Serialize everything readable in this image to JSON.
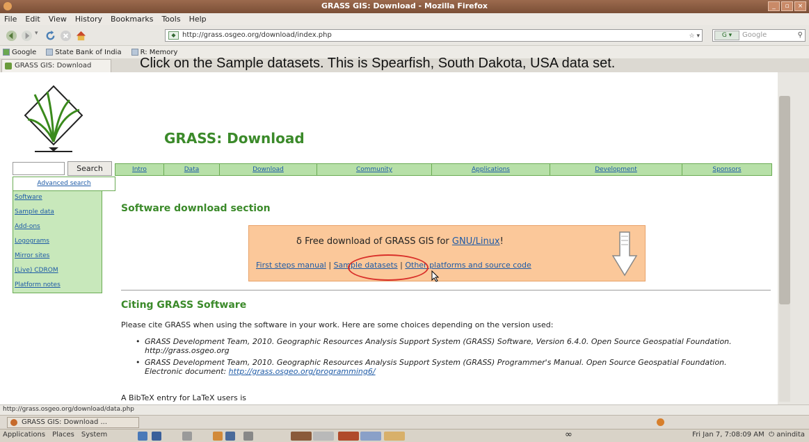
{
  "window": {
    "title": "GRASS GIS: Download - Mozilla Firefox",
    "buttons": [
      "_",
      "▫",
      "×"
    ]
  },
  "menubar": [
    "File",
    "Edit",
    "View",
    "History",
    "Bookmarks",
    "Tools",
    "Help"
  ],
  "navbar": {
    "url": "http://grass.osgeo.org/download/index.php",
    "search_engine": "Google",
    "search_placeholder": "Google"
  },
  "bookmarks": [
    "Google",
    "State Bank of India",
    "R: Memory"
  ],
  "tab": {
    "label": "GRASS GIS: Download"
  },
  "caption": "Click on the Sample datasets. This is Spearfish, South Dakota, USA data set.",
  "page": {
    "title": "GRASS: Download",
    "search_button": "Search",
    "advanced_search": "Advanced search",
    "top_nav": [
      "Intro",
      "Data",
      "Download",
      "Community",
      "Applications",
      "Development",
      "Sponsors"
    ],
    "sidebar": [
      "Software",
      "Sample data",
      "Add-ons",
      "Logograms",
      "Mirror sites",
      "(Live) CDROM",
      "Platform notes"
    ],
    "section_heading": "Software download section",
    "download_box": {
      "lead_symbol": "δ",
      "free_text": "Free download of GRASS GIS for ",
      "platform_link": "GNU/Linux",
      "exclam": "!",
      "link_first_steps": "First steps manual",
      "sep1": " | ",
      "link_sample": "Sample datasets",
      "sep2": " | ",
      "link_other": "Other platforms and source code"
    },
    "cite_heading": "Citing GRASS Software",
    "cite_intro": "Please cite GRASS when using the software in your work. Here are some choices depending on the version used:",
    "citations": [
      {
        "text1": "GRASS Development Team, 2010. Geographic Resources Analysis Support System (GRASS) Software, Version 6.4.0. Open Source Geospatial Foundation. http://grass.osgeo.org",
        "link": ""
      },
      {
        "text1": "GRASS Development Team, 2010. Geographic Resources Analysis Support System (GRASS) Programmer's Manual. Open Source Geospatial Foundation. Electronic document: ",
        "link": "http://grass.osgeo.org/programming6/"
      }
    ],
    "bibtex": "A BibTeX entry for LaTeX users is"
  },
  "statusbar": "http://grass.osgeo.org/download/data.php",
  "taskbar": {
    "window_button": "GRASS GIS: Download ...",
    "menus": [
      "Applications",
      "Places",
      "System"
    ],
    "clock": "Fri Jan 7, 7:08:09 AM",
    "user": "anindita"
  }
}
